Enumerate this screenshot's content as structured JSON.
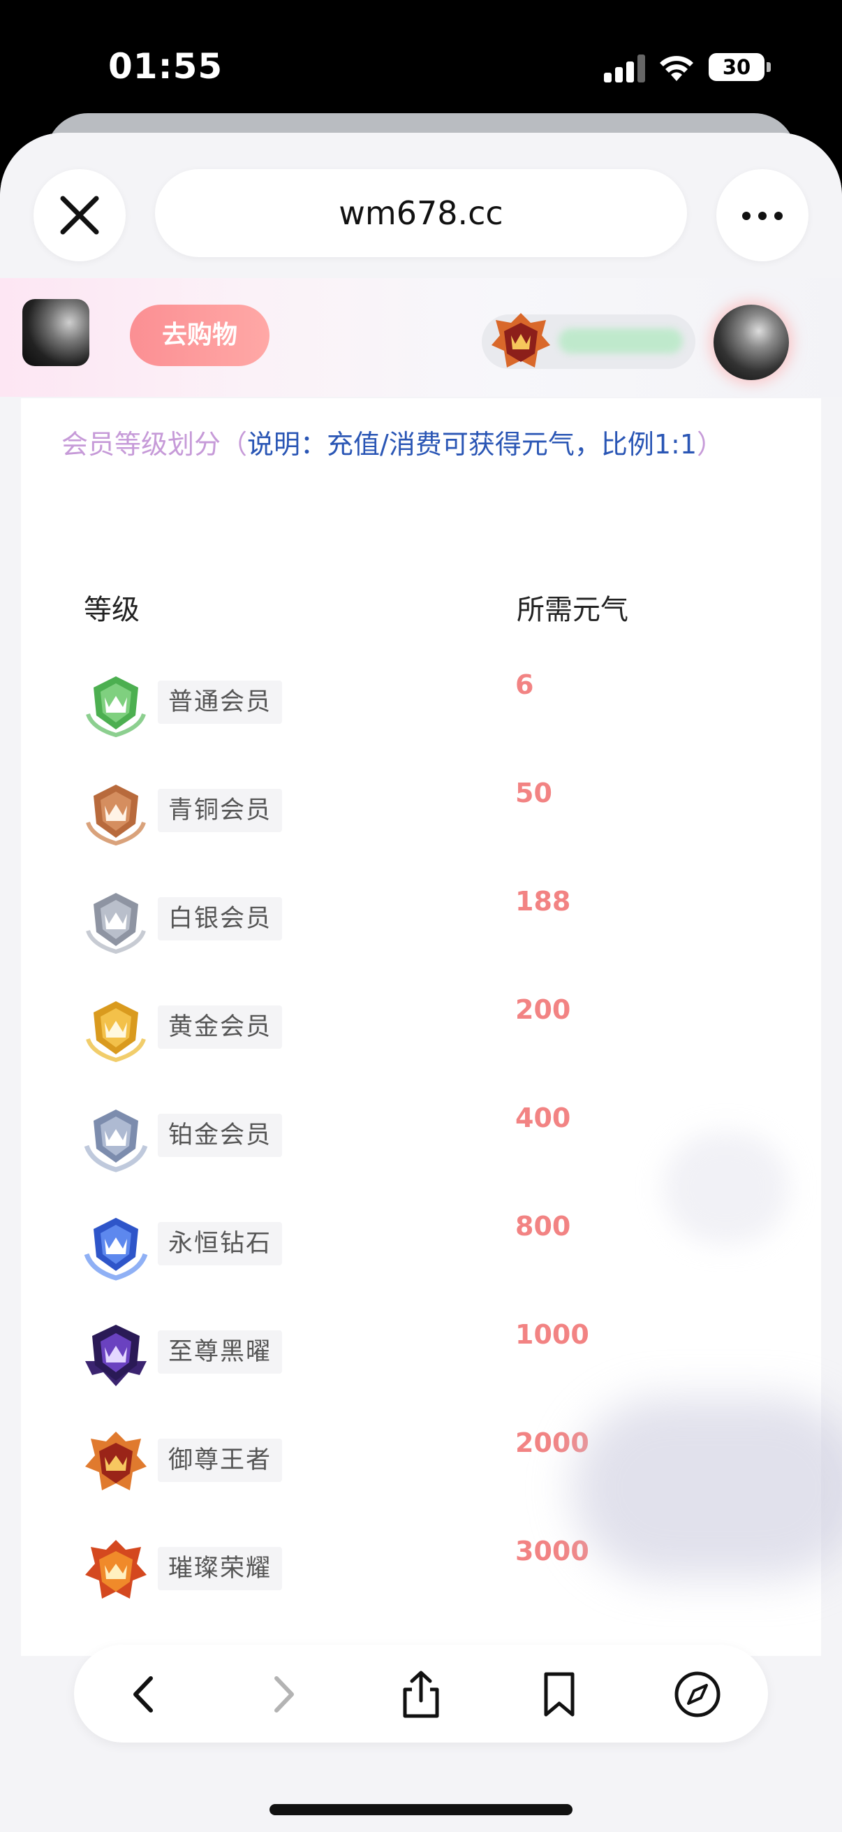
{
  "status_bar": {
    "time": "01:55",
    "battery": "30"
  },
  "browser": {
    "url": "wm678.cc"
  },
  "header": {
    "shop_button": "去购物"
  },
  "intro": {
    "title": "会员等级划分",
    "open_paren": "（",
    "note": "说明：充值/消费可获得元气，比例1:1",
    "close_paren": "）"
  },
  "table": {
    "headers": [
      "等级",
      "所需元气"
    ],
    "rows": [
      {
        "name": "普通会员",
        "value": "6",
        "icon": "green-crown-badge-icon",
        "color": "#4caf50"
      },
      {
        "name": "青铜会员",
        "value": "50",
        "icon": "bronze-crown-badge-icon",
        "color": "#c07a4b"
      },
      {
        "name": "白银会员",
        "value": "188",
        "icon": "silver-crown-badge-icon",
        "color": "#9aa0ad"
      },
      {
        "name": "黄金会员",
        "value": "200",
        "icon": "gold-crown-badge-icon",
        "color": "#e2a92a"
      },
      {
        "name": "铂金会员",
        "value": "400",
        "icon": "platinum-crown-badge-icon",
        "color": "#8d9bb8"
      },
      {
        "name": "永恒钻石",
        "value": "800",
        "icon": "diamond-crown-badge-icon",
        "color": "#3e6be0"
      },
      {
        "name": "至尊黑曜",
        "value": "1000",
        "icon": "obsidian-crown-badge-icon",
        "color": "#4a2c8a"
      },
      {
        "name": "御尊王者",
        "value": "2000",
        "icon": "king-crown-badge-icon",
        "color": "#d4622b"
      },
      {
        "name": "璀璨荣耀",
        "value": "3000",
        "icon": "glory-crown-badge-icon",
        "color": "#c9381f"
      }
    ]
  },
  "colors": {
    "accent_pink": "#f28383",
    "link_blue": "#2a56b5",
    "title_purple": "#c69ad8"
  }
}
